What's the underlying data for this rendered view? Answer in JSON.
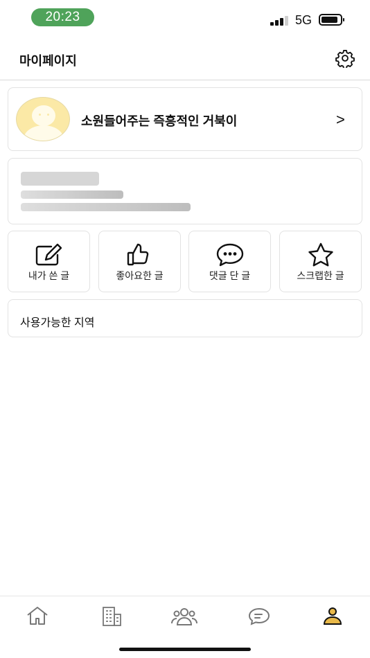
{
  "status_bar": {
    "time": "20:23",
    "network": "5G",
    "battery_level": 0.9
  },
  "header": {
    "title": "마이페이지"
  },
  "profile": {
    "nickname": "소원들어주는 즉흥적인 거북이",
    "chevron": ">"
  },
  "actions": [
    {
      "label": "내가 쓴 글",
      "icon": "edit-icon"
    },
    {
      "label": "좋아요한 글",
      "icon": "thumbs-up-icon"
    },
    {
      "label": "댓글 단 글",
      "icon": "chat-bubble-icon"
    },
    {
      "label": "스크랩한 글",
      "icon": "star-icon"
    }
  ],
  "region": {
    "label": "사용가능한 지역"
  },
  "tab_bar": {
    "tabs": [
      {
        "icon": "home-icon"
      },
      {
        "icon": "building-icon"
      },
      {
        "icon": "people-icon"
      },
      {
        "icon": "chat-icon"
      },
      {
        "icon": "profile-icon",
        "active": true
      }
    ],
    "accent_color": "#e9b949"
  },
  "colors": {
    "time_pill": "#4fa35a",
    "avatar_bg": "#fbe9a6"
  }
}
